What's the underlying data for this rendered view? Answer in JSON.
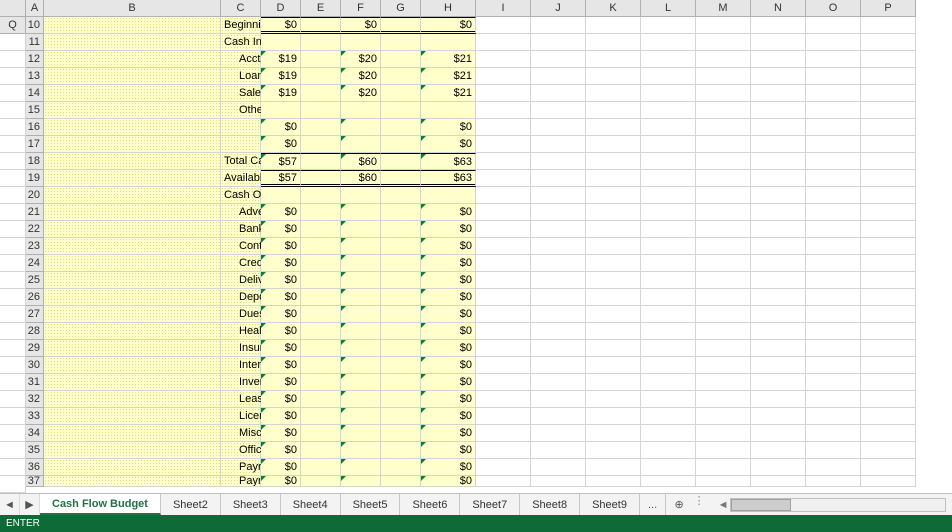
{
  "columns": [
    "A",
    "B",
    "C",
    "D",
    "E",
    "F",
    "G",
    "H",
    "I",
    "J",
    "K",
    "L",
    "M",
    "N",
    "O",
    "P",
    "Q"
  ],
  "rows": [
    {
      "n": 10,
      "label": "Beginning Cash Balance",
      "vals": {
        "C": "$0",
        "E": "$0",
        "G": "$0"
      },
      "labelClass": "",
      "topline": true,
      "dbl": true
    },
    {
      "n": 11,
      "label": "Cash Inflows (Income):",
      "vals": {},
      "labelClass": ""
    },
    {
      "n": 12,
      "label": "Accts. Rec. Collections",
      "vals": {
        "C": "$19",
        "E": "$20",
        "G": "$21"
      },
      "labelClass": "indent1",
      "tri": [
        "C",
        "E",
        "G"
      ]
    },
    {
      "n": 13,
      "label": "Loan Proceeds",
      "vals": {
        "C": "$19",
        "E": "$20",
        "G": "$21"
      },
      "labelClass": "indent1",
      "tri": [
        "C",
        "E",
        "G"
      ]
    },
    {
      "n": 14,
      "label": "Sales & Receipts",
      "vals": {
        "C": "$19",
        "E": "$20",
        "G": "$21"
      },
      "labelClass": "indent1",
      "tri": [
        "C",
        "E",
        "G"
      ]
    },
    {
      "n": 15,
      "label": "Other:",
      "vals": {},
      "labelClass": "indent1"
    },
    {
      "n": 16,
      "label": "",
      "vals": {
        "C": "$0",
        "G": "$0"
      },
      "labelClass": "indent1",
      "tri": [
        "C",
        "E",
        "G"
      ]
    },
    {
      "n": 17,
      "label": "",
      "vals": {
        "C": "$0",
        "G": "$0"
      },
      "labelClass": "indent1",
      "tri": [
        "C",
        "E",
        "G"
      ]
    },
    {
      "n": 18,
      "label": "Total Cash Inflows",
      "vals": {
        "C": "$57",
        "E": "$60",
        "G": "$63"
      },
      "labelClass": "indent2",
      "topline": true,
      "tri": [
        "C",
        "E",
        "G"
      ]
    },
    {
      "n": 19,
      "label": "Available Cash Balance",
      "vals": {
        "C": "$57",
        "E": "$60",
        "G": "$63"
      },
      "labelClass": "",
      "topline": true,
      "dbl": true
    },
    {
      "n": 20,
      "label": "Cash Outflows (Expenses):",
      "vals": {},
      "labelClass": ""
    },
    {
      "n": 21,
      "label": "Advertising",
      "vals": {
        "C": "$0",
        "G": "$0"
      },
      "labelClass": "indent1",
      "tri": [
        "C",
        "E",
        "G"
      ]
    },
    {
      "n": 22,
      "label": "Bank Service Charges",
      "vals": {
        "C": "$0",
        "G": "$0"
      },
      "labelClass": "indent1",
      "tri": [
        "C",
        "E",
        "G"
      ]
    },
    {
      "n": 23,
      "label": "Contingencies",
      "vals": {
        "C": "$0",
        "G": "$0"
      },
      "labelClass": "indent1",
      "tri": [
        "C",
        "E",
        "G"
      ]
    },
    {
      "n": 24,
      "label": "Credit Card Fees",
      "vals": {
        "C": "$0",
        "G": "$0"
      },
      "labelClass": "indent1",
      "tri": [
        "C",
        "E",
        "G"
      ]
    },
    {
      "n": 25,
      "label": "Delivery Charges",
      "vals": {
        "C": "$0",
        "G": "$0"
      },
      "labelClass": "indent1",
      "tri": [
        "C",
        "E",
        "G"
      ]
    },
    {
      "n": 26,
      "label": "Deposits",
      "vals": {
        "C": "$0",
        "G": "$0"
      },
      "labelClass": "indent1",
      "tri": [
        "C",
        "E",
        "G"
      ]
    },
    {
      "n": 27,
      "label": "Dues & Subscriptions",
      "vals": {
        "C": "$0",
        "G": "$0"
      },
      "labelClass": "indent1",
      "tri": [
        "C",
        "E",
        "G"
      ]
    },
    {
      "n": 28,
      "label": "Health Insurance",
      "vals": {
        "C": "$0",
        "G": "$0"
      },
      "labelClass": "indent1",
      "tri": [
        "C",
        "E",
        "G"
      ]
    },
    {
      "n": 29,
      "label": "Insurance",
      "vals": {
        "C": "$0",
        "G": "$0"
      },
      "labelClass": "indent1",
      "tri": [
        "C",
        "E",
        "G"
      ]
    },
    {
      "n": 30,
      "label": "Interest",
      "vals": {
        "C": "$0",
        "G": "$0"
      },
      "labelClass": "indent1",
      "tri": [
        "C",
        "E",
        "G"
      ]
    },
    {
      "n": 31,
      "label": "Inventory Purchases",
      "vals": {
        "C": "$0",
        "G": "$0"
      },
      "labelClass": "indent1",
      "tri": [
        "C",
        "E",
        "G"
      ]
    },
    {
      "n": 32,
      "label": "Lease Payments",
      "vals": {
        "C": "$0",
        "G": "$0"
      },
      "labelClass": "indent1",
      "tri": [
        "C",
        "E",
        "G"
      ]
    },
    {
      "n": 33,
      "label": "Licenses & Permits",
      "vals": {
        "C": "$0",
        "G": "$0"
      },
      "labelClass": "indent1",
      "tri": [
        "C",
        "E",
        "G"
      ]
    },
    {
      "n": 34,
      "label": "Miscellaneous",
      "vals": {
        "C": "$0",
        "G": "$0"
      },
      "labelClass": "indent1",
      "tri": [
        "C",
        "E",
        "G"
      ]
    },
    {
      "n": 35,
      "label": "Office",
      "vals": {
        "C": "$0",
        "G": "$0"
      },
      "labelClass": "indent1",
      "tri": [
        "C",
        "E",
        "G"
      ]
    },
    {
      "n": 36,
      "label": "Payroll",
      "vals": {
        "C": "$0",
        "G": "$0"
      },
      "labelClass": "indent1",
      "tri": [
        "C",
        "E",
        "G"
      ]
    },
    {
      "n": 37,
      "label": "Payroll Taxes",
      "vals": {
        "C": "$0",
        "G": "$0"
      },
      "labelClass": "indent1",
      "tri": [
        "C",
        "E",
        "G"
      ],
      "partial": true
    }
  ],
  "tabs": {
    "active": "Cash Flow Budget",
    "items": [
      "Cash Flow Budget",
      "Sheet2",
      "Sheet3",
      "Sheet4",
      "Sheet5",
      "Sheet6",
      "Sheet7",
      "Sheet8",
      "Sheet9"
    ],
    "more": "..."
  },
  "nav": {
    "first": "◄",
    "prev": "▶"
  },
  "status": "ENTER",
  "addIcon": "⊕",
  "scrollLeft": "◄"
}
